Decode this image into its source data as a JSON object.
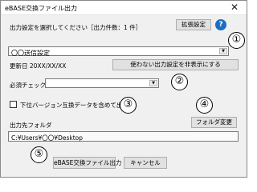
{
  "window": {
    "title": "eBASE交換ファイル出力",
    "close_label": "✕"
  },
  "settings": {
    "prompt": "出力設定を選択してください［出力件数：1 件］",
    "ext_button": "拡張設定",
    "help_label": "?",
    "selected": "〇〇送信設定",
    "updated": "更新日 20XX/XX/XX",
    "hide_button": "使わない出力設定を非表示にする"
  },
  "required_check": {
    "label": "必須チェック",
    "value": ""
  },
  "compat": {
    "label": "下位バージョン互換データを含めて出力",
    "checked": false
  },
  "folder": {
    "label": "出力先フォルダ",
    "change_button": "フォルダ変更",
    "path": "C:¥Users¥〇〇¥Desktop"
  },
  "footer": {
    "export_button": "eBASE交換ファイル出力",
    "cancel_button": "キャンセル"
  },
  "markers": [
    "①",
    "②",
    "③",
    "④",
    "⑤"
  ],
  "colors": {
    "help_icon": "#1a6fc4"
  }
}
